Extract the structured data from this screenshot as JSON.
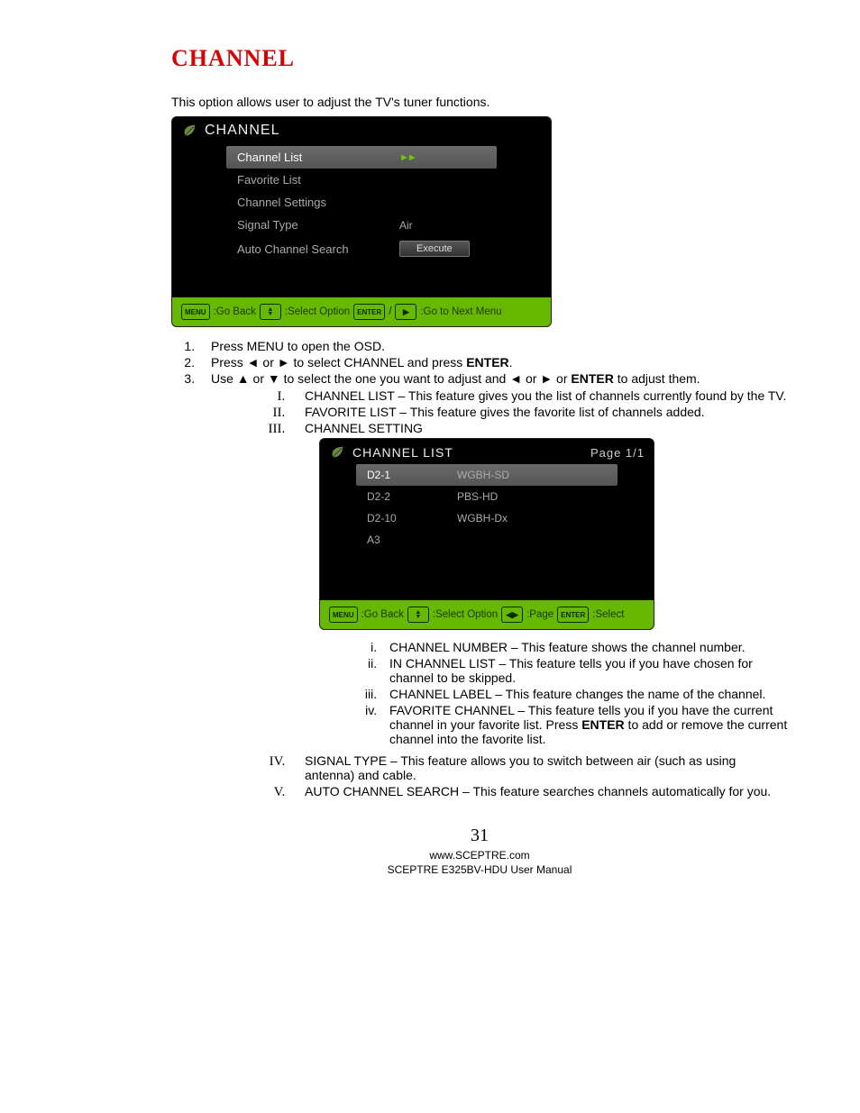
{
  "title": "CHANNEL",
  "intro": "This option allows user to adjust the TV's tuner functions.",
  "osd1": {
    "header": "CHANNEL",
    "rows": [
      {
        "label": "Channel List",
        "value": "",
        "selected": true,
        "arrows": true
      },
      {
        "label": "Favorite List",
        "value": ""
      },
      {
        "label": "Channel Settings",
        "value": ""
      },
      {
        "label": "Signal Type",
        "value": "Air"
      },
      {
        "label": "Auto Channel Search",
        "value": "",
        "button": "Execute"
      }
    ],
    "footer": {
      "k1": "MENU",
      "t1": ":Go Back",
      "t2": ":Select Option",
      "k3": "ENTER",
      "t3": ":Go to Next Menu"
    }
  },
  "steps": {
    "s1": "Press MENU to open the OSD.",
    "s2_a": "Press ◄ or ► to select CHANNEL and press ",
    "s2_b": "ENTER",
    "s2_c": ".",
    "s3_a": "Use ▲ or ▼ to select the one you want to adjust and ◄ or ► or ",
    "s3_b": "ENTER",
    "s3_c": " to adjust them."
  },
  "roman": {
    "r1": "CHANNEL LIST – This feature gives you the list of channels currently found by the TV.",
    "r2": "FAVORITE LIST – This feature gives the favorite list of channels added.",
    "r3": "CHANNEL SETTING",
    "r4": "SIGNAL TYPE – This feature allows you to switch between air (such as using antenna) and cable.",
    "r5": "AUTO CHANNEL SEARCH – This feature searches channels automatically for you."
  },
  "osd2": {
    "header": "CHANNEL LIST",
    "page": "Page 1/1",
    "rows": [
      {
        "label": "D2-1",
        "value": "WGBH-SD",
        "selected": true
      },
      {
        "label": "D2-2",
        "value": "PBS-HD"
      },
      {
        "label": "D2-10",
        "value": "WGBH-Dx"
      },
      {
        "label": "A3",
        "value": ""
      }
    ],
    "footer": {
      "k1": "MENU",
      "t1": ":Go Back",
      "t2": ":Select Option",
      "t3": ":Page",
      "k4": "ENTER",
      "t4": ":Select"
    }
  },
  "lroman": {
    "i1": "CHANNEL NUMBER – This feature shows the channel number.",
    "i2": "IN CHANNEL LIST – This feature tells you if you have chosen for channel to be skipped.",
    "i3": "CHANNEL LABEL – This feature changes the name of the channel.",
    "i4_a": "FAVORITE CHANNEL – This feature tells you if you have the current channel in your favorite list. Press ",
    "i4_b": "ENTER",
    "i4_c": " to add or remove the current channel into the favorite list."
  },
  "footer": {
    "pagenum": "31",
    "line1": "www.SCEPTRE.com",
    "line2": "SCEPTRE E325BV-HDU User Manual"
  }
}
